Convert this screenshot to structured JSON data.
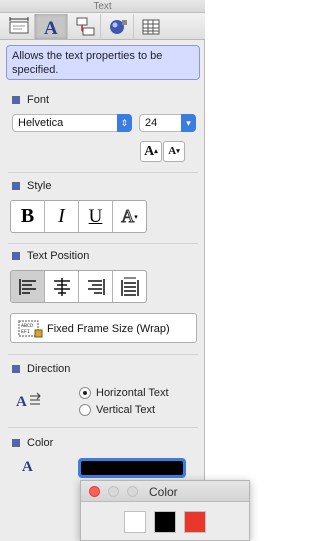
{
  "window": {
    "title": "Text"
  },
  "toolbar": {
    "tabs": [
      "Geometry",
      "Text",
      "Connections",
      "Style",
      "Table"
    ]
  },
  "tip": "Allows the text properties to be specified.",
  "font": {
    "heading": "Font",
    "family": "Helvetica",
    "size": "24",
    "bigger_label": "A",
    "smaller_label": "A"
  },
  "style": {
    "heading": "Style",
    "bold": "B",
    "italic": "I",
    "underline": "U",
    "more": "A"
  },
  "text_position": {
    "heading": "Text Position",
    "alignments": [
      "left",
      "center",
      "right",
      "justify"
    ],
    "selected": "left",
    "frame_button": "Fixed Frame Size (Wrap)"
  },
  "direction": {
    "heading": "Direction",
    "options": [
      "Horizontal Text",
      "Vertical Text"
    ],
    "selected": "Horizontal Text"
  },
  "color": {
    "heading": "Color",
    "icon_label": "A",
    "current": "#000000",
    "accent": "#3a7de0"
  },
  "color_window": {
    "title": "Color",
    "swatches": [
      "#ffffff",
      "#000000",
      "#e8382b"
    ]
  }
}
